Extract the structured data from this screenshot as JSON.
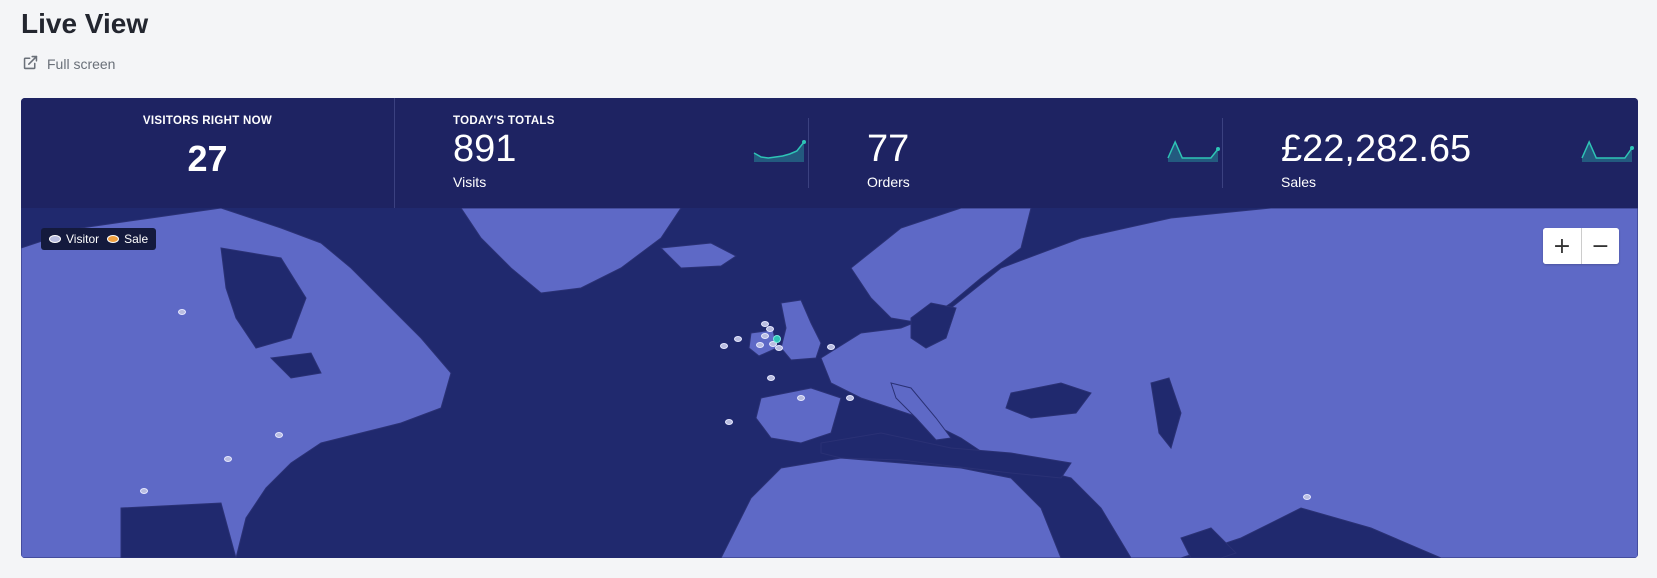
{
  "header": {
    "title": "Live View",
    "fullscreen_label": "Full screen"
  },
  "stats": {
    "visitors_label": "VISITORS RIGHT NOW",
    "visitors_value": "27",
    "totals_label": "TODAY'S TOTALS",
    "metrics": [
      {
        "value": "891",
        "label": "Visits",
        "sparkline": [
          0.35,
          0.15,
          0.1,
          0.15,
          0.2,
          0.3,
          0.45,
          0.9
        ]
      },
      {
        "value": "77",
        "label": "Orders",
        "sparkline": [
          0.1,
          0.9,
          0.1,
          0.1,
          0.1,
          0.1,
          0.1,
          0.55
        ]
      },
      {
        "value": "£22,282.65",
        "label": "Sales",
        "sparkline": [
          0.1,
          0.9,
          0.1,
          0.1,
          0.1,
          0.1,
          0.1,
          0.6
        ]
      }
    ],
    "sparkline_color": "#2ec4b6"
  },
  "map": {
    "legend": {
      "visitor": "Visitor",
      "sale": "Sale"
    },
    "zoom_in": "+",
    "zoom_out": "−",
    "colors": {
      "water": "#20296e",
      "land": "#5e69c6",
      "border": "#2a3175",
      "panel": "#1e2362"
    }
  }
}
